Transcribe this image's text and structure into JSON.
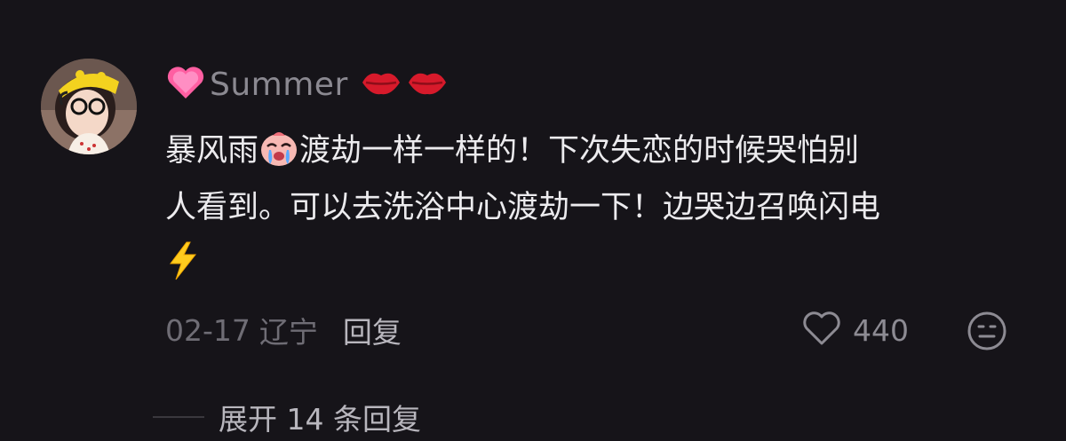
{
  "comment": {
    "username": "Summer",
    "text_lines": [
      {
        "before_emoji": "暴风雨",
        "after_emoji": "渡劫一样一样的！下次失恋的时候哭怕别"
      },
      {
        "text": "人看到。可以去洗浴中心渡劫一下！边哭边召唤闪电"
      }
    ],
    "date": "02-17",
    "location": "辽宁",
    "reply_label": "回复",
    "like_count": "440",
    "expand_replies_label": "展开 14 条回复"
  },
  "icons": {
    "name_prefix": "pink-heart-icon",
    "name_suffix": [
      "kiss-lips-icon",
      "kiss-lips-icon"
    ],
    "inline_emoji": "crying-face-icon",
    "trailing_emoji": "lightning-icon",
    "like": "heart-outline-icon",
    "dislike": "meh-face-icon"
  },
  "colors": {
    "background": "#161419",
    "text_primary": "#ecebee",
    "text_secondary": "#8b8991",
    "text_muted": "#6f6d75"
  }
}
